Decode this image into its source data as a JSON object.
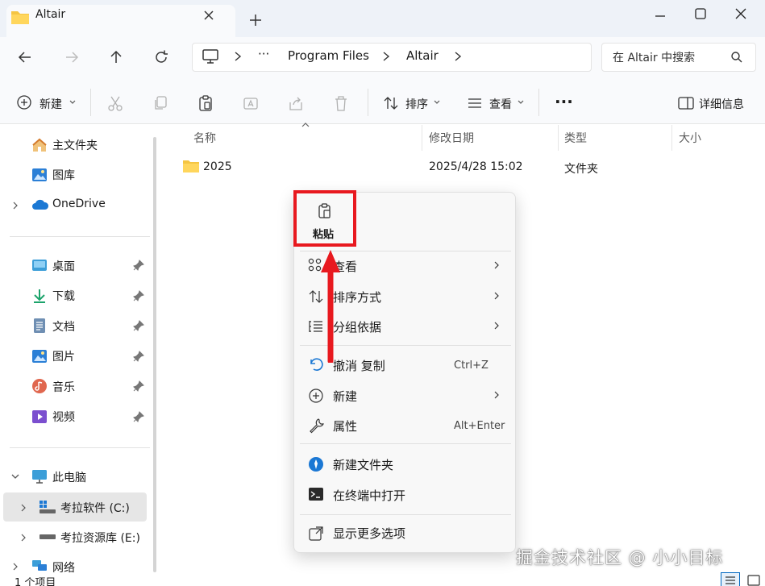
{
  "window": {
    "tab_title": "Altair",
    "new_tab": "+"
  },
  "address": {
    "more": "···",
    "crumbs": [
      "Program Files",
      "Altair"
    ]
  },
  "search": {
    "placeholder": "在 Altair 中搜索"
  },
  "commands": {
    "new": "新建",
    "sort": "排序",
    "view": "查看",
    "more": "···",
    "details": "详细信息"
  },
  "sidebar": {
    "items": [
      {
        "label": "主文件夹",
        "icon": "home-icon"
      },
      {
        "label": "图库",
        "icon": "gallery-icon"
      },
      {
        "label": "OneDrive",
        "icon": "cloud-icon"
      },
      {
        "label": "桌面",
        "icon": "desktop-icon"
      },
      {
        "label": "下载",
        "icon": "download-icon"
      },
      {
        "label": "文档",
        "icon": "document-icon"
      },
      {
        "label": "图片",
        "icon": "pictures-icon"
      },
      {
        "label": "音乐",
        "icon": "music-icon"
      },
      {
        "label": "视频",
        "icon": "video-icon"
      },
      {
        "label": "此电脑",
        "icon": "pc-icon"
      },
      {
        "label": "考拉软件 (C:)",
        "icon": "drive-c-icon"
      },
      {
        "label": "考拉资源库 (E:)",
        "icon": "drive-e-icon"
      },
      {
        "label": "网络",
        "icon": "network-icon"
      }
    ]
  },
  "filelist": {
    "columns": [
      "名称",
      "修改日期",
      "类型",
      "大小"
    ],
    "rows": [
      {
        "name": "2025",
        "modified": "2025/4/28 15:02",
        "type": "文件夹",
        "size": ""
      }
    ]
  },
  "context_menu": {
    "paste": "粘贴",
    "items": [
      {
        "label": "查看",
        "shortcut": "",
        "submenu": true,
        "icon": "grid-icon"
      },
      {
        "label": "排序方式",
        "shortcut": "",
        "submenu": true,
        "icon": "sort-icon"
      },
      {
        "label": "分组依据",
        "shortcut": "",
        "submenu": true,
        "icon": "group-icon"
      },
      {
        "label": "撤消 复制",
        "shortcut": "Ctrl+Z",
        "submenu": false,
        "icon": "undo-icon"
      },
      {
        "label": "新建",
        "shortcut": "",
        "submenu": true,
        "icon": "plus-circle-icon"
      },
      {
        "label": "属性",
        "shortcut": "Alt+Enter",
        "submenu": false,
        "icon": "wrench-icon"
      },
      {
        "label": "新建文件夹",
        "shortcut": "",
        "submenu": false,
        "icon": "new-folder-icon"
      },
      {
        "label": "在终端中打开",
        "shortcut": "",
        "submenu": false,
        "icon": "terminal-icon"
      },
      {
        "label": "显示更多选项",
        "shortcut": "",
        "submenu": false,
        "icon": "more-options-icon"
      }
    ]
  },
  "status": {
    "count": "1 个项目"
  },
  "watermark": "掘金技术社区 @ 小小目标",
  "colors": {
    "accent": "#0067c0",
    "highlight_red": "#e8191f",
    "folder_yellow": "#f5c542"
  }
}
